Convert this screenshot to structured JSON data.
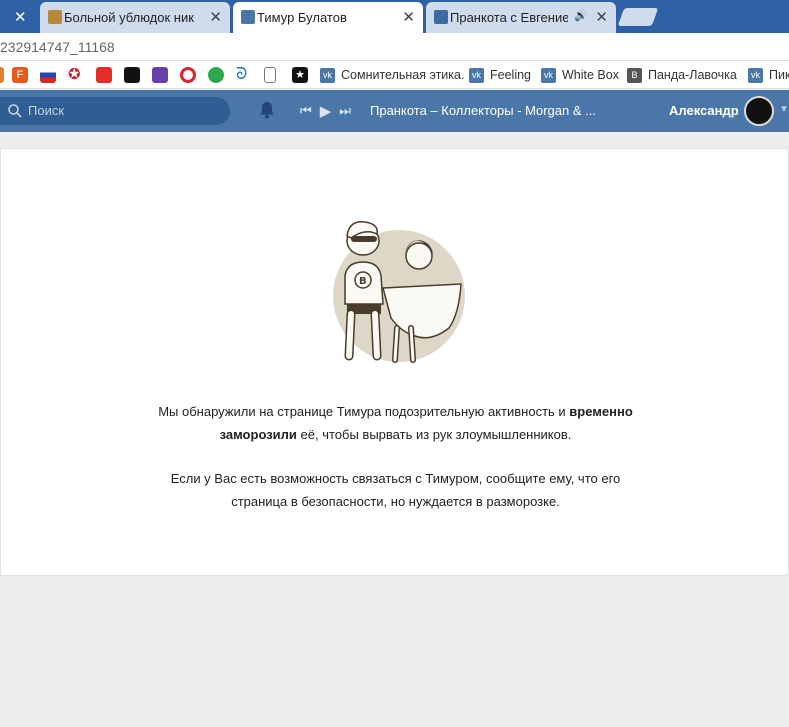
{
  "tabs": [
    {
      "title": "Больной ублюдок ника",
      "active": false
    },
    {
      "title": "Тимур Булатов",
      "active": true
    },
    {
      "title": "Пранкота с Евгение",
      "active": false
    }
  ],
  "address": "232914747_11168",
  "bookmarks": [
    {
      "label": "Сомнительная этика."
    },
    {
      "label": "Feeling"
    },
    {
      "label": "White Box"
    },
    {
      "label": "Панда-Лавочка"
    },
    {
      "label": "Пик"
    }
  ],
  "vk": {
    "search_placeholder": "Поиск",
    "now_playing": "Пранкота – Коллекторы - Morgan & ...",
    "user_name": "Александр"
  },
  "notice": {
    "p1_start": "Мы обнаружили на странице Тимура подозрительную активность и ",
    "p1_bold_a": "временно",
    "p1_bold_b": "заморозили",
    "p1_end": " её, чтобы вырвать из рук злоумышленников.",
    "p2_line1": "Если у Вас есть возможность связаться с Тимуром, сообщите ему, что его",
    "p2_line2": "страница в безопасности, но нуждается в разморозке."
  },
  "colors": {
    "vk_blue": "#4a76a8",
    "tab_bar": "#2f62a4"
  }
}
